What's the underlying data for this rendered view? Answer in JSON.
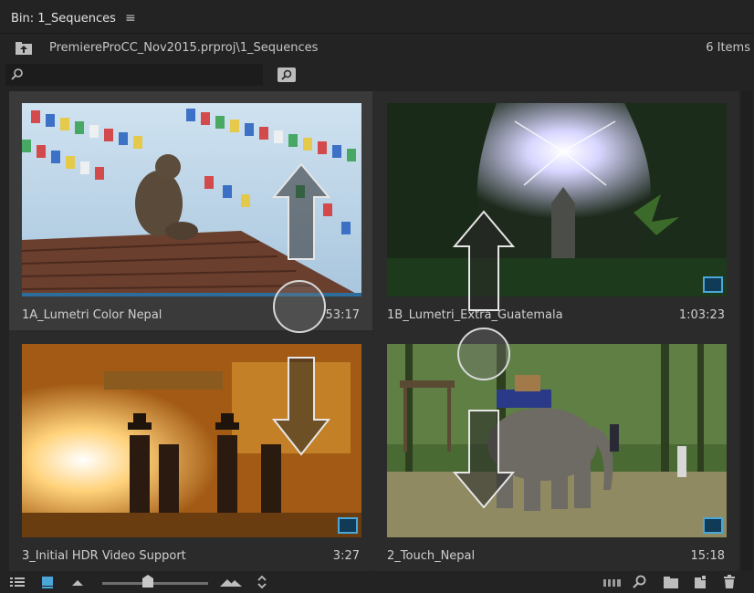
{
  "panel": {
    "title": "Bin: 1_Sequences",
    "menu_icon": "hamburger-menu-icon"
  },
  "path": {
    "text": "PremiereProCC_Nov2015.prproj\\1_Sequences",
    "item_count": "6 Items"
  },
  "search": {
    "value": "",
    "placeholder": ""
  },
  "items": [
    {
      "name": "1A_Lumetri Color Nepal",
      "duration": "53:17"
    },
    {
      "name": "1B_Lumetri_Extra_Guatemala",
      "duration": "1:03:23"
    },
    {
      "name": "3_Initial HDR Video Support",
      "duration": "3:27"
    },
    {
      "name": "2_Touch_Nepal",
      "duration": "15:18"
    }
  ],
  "bottom_bar": {
    "icons": [
      "list-view-icon",
      "icon-view-icon",
      "zoom-out-icon",
      "zoom-slider",
      "zoom-in-icon",
      "sort-icon",
      "automate-to-sequence-icon",
      "find-icon",
      "new-bin-icon",
      "new-item-icon",
      "clear-icon"
    ],
    "zoom_level": 0.45
  },
  "colors": {
    "accent": "#4aa7d8",
    "background": "#232323",
    "selected_tile": "#3a3a3a"
  }
}
